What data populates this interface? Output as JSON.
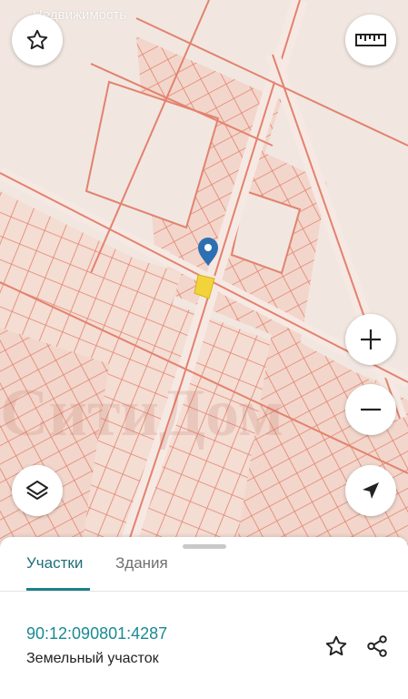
{
  "map": {
    "watermark_top": "Недвижимость",
    "watermark_center": "СитиДом",
    "colors": {
      "background": "#f1e7e0",
      "parcel_line": "#e3826f",
      "parcel_fill": "#efcdbf",
      "marker_blue": "#2c6fb2",
      "selected_parcel": "#f2d33a"
    },
    "buttons": {
      "favorite": "star-icon",
      "ruler": "ruler-icon",
      "zoom_in": "plus-icon",
      "zoom_out": "minus-icon",
      "layers": "layers-icon",
      "locate": "navigation-arrow-icon"
    }
  },
  "sheet": {
    "tabs": [
      {
        "label": "Участки",
        "active": true
      },
      {
        "label": "Здания",
        "active": false
      }
    ],
    "parcel": {
      "cadastral_number": "90:12:090801:4287",
      "type": "Земельный участок"
    },
    "actions": {
      "favorite": "star-outline-icon",
      "share": "share-icon"
    }
  }
}
